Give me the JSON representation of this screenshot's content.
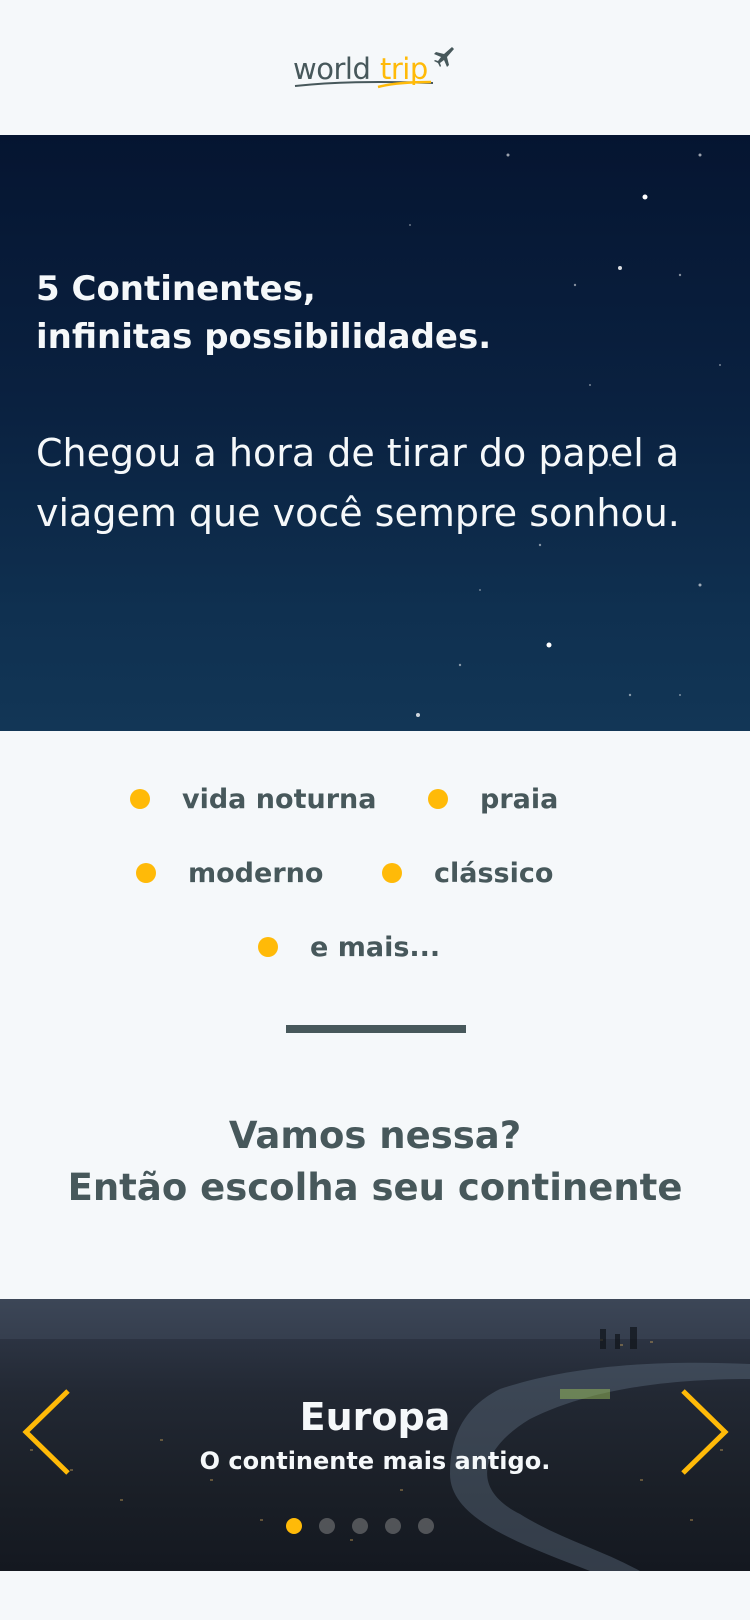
{
  "header": {
    "logo_world": "world",
    "logo_trip": "trip"
  },
  "hero": {
    "title_line1": "5 Continentes,",
    "title_line2": "infinitas possibilidades.",
    "text": "Chegou a hora de tirar do papel a viagem que você sempre sonhou."
  },
  "travel_types": [
    {
      "label": "vida noturna"
    },
    {
      "label": "praia"
    },
    {
      "label": "moderno"
    },
    {
      "label": "clássico"
    },
    {
      "label": "e mais..."
    }
  ],
  "cta": {
    "line1": "Vamos nessa?",
    "line2": "Então escolha seu continente"
  },
  "slider": {
    "title": "Europa",
    "subtitle": "O continente mais antigo.",
    "slides_count": 5,
    "active_slide": 1,
    "prev_icon": "chevron-left-icon",
    "next_icon": "chevron-right-icon"
  },
  "colors": {
    "accent": "#ffba08",
    "text": "#47585b",
    "background": "#f5f8fa",
    "light_text": "#f5f8fa"
  }
}
